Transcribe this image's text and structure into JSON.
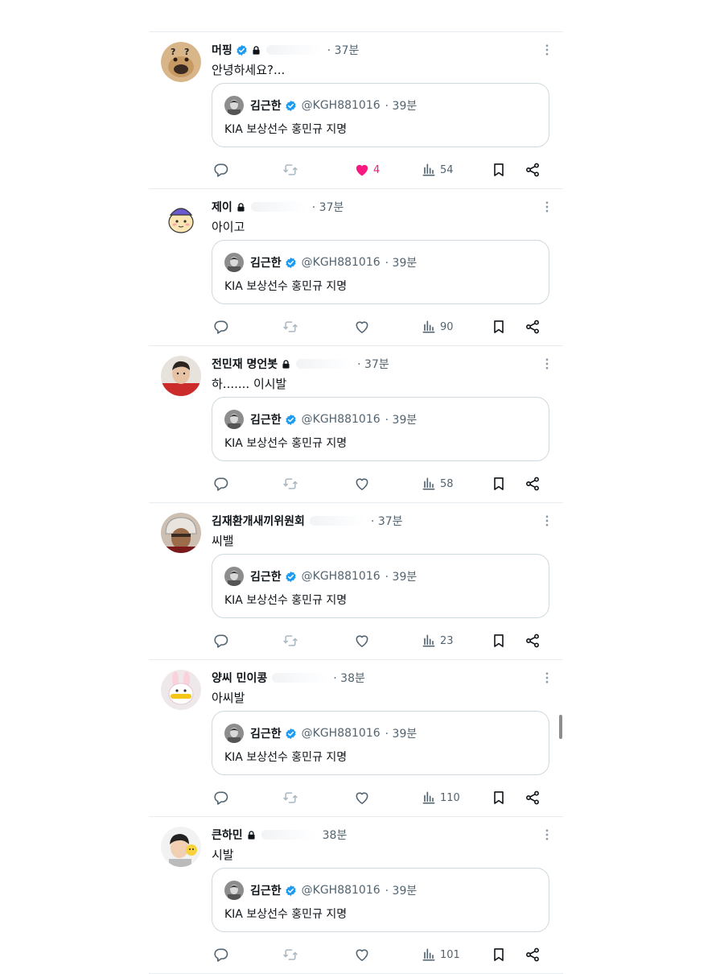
{
  "quoted_post": {
    "author_name": "김근한",
    "author_handle": "@KGH881016",
    "time": "· 39분",
    "text": "KIA 보상선수 홍민규 지명"
  },
  "colors": {
    "verified": "#1d9bf0",
    "like_active": "#f91880",
    "text_primary": "#0f1419",
    "text_secondary": "#536471",
    "border": "#cfd9de"
  },
  "tweets": [
    {
      "author_name": "머핑",
      "verified": true,
      "locked": true,
      "time": "· 37분",
      "text": "안녕하세요?...",
      "avatar_icon": "cartoon-dog-avatar",
      "liked": true,
      "like_count": "4",
      "view_count": "54"
    },
    {
      "author_name": "제이",
      "verified": false,
      "locked": true,
      "time": "· 37분",
      "text": "아이고",
      "avatar_icon": "cartoon-character-avatar",
      "liked": false,
      "like_count": "",
      "view_count": "90"
    },
    {
      "author_name": "전민재 명언봇",
      "verified": false,
      "locked": true,
      "time": "· 37분",
      "text": "하....... 이시발",
      "avatar_icon": "player-photo-avatar",
      "liked": false,
      "like_count": "",
      "view_count": "58"
    },
    {
      "author_name": "김재환개새끼위원회",
      "verified": false,
      "locked": false,
      "time": "· 37분",
      "text": "씨밸",
      "avatar_icon": "helmet-photo-avatar",
      "liked": false,
      "like_count": "",
      "view_count": "23"
    },
    {
      "author_name": "양씨 민이콩",
      "verified": false,
      "locked": false,
      "time": "· 38분",
      "text": "아씨발",
      "avatar_icon": "rabbit-plush-avatar",
      "liked": false,
      "like_count": "",
      "view_count": "110"
    },
    {
      "author_name": "큰하민",
      "verified": false,
      "locked": true,
      "time": "38분",
      "text": "시발",
      "avatar_icon": "boy-photo-avatar",
      "liked": false,
      "like_count": "",
      "view_count": "101"
    }
  ]
}
